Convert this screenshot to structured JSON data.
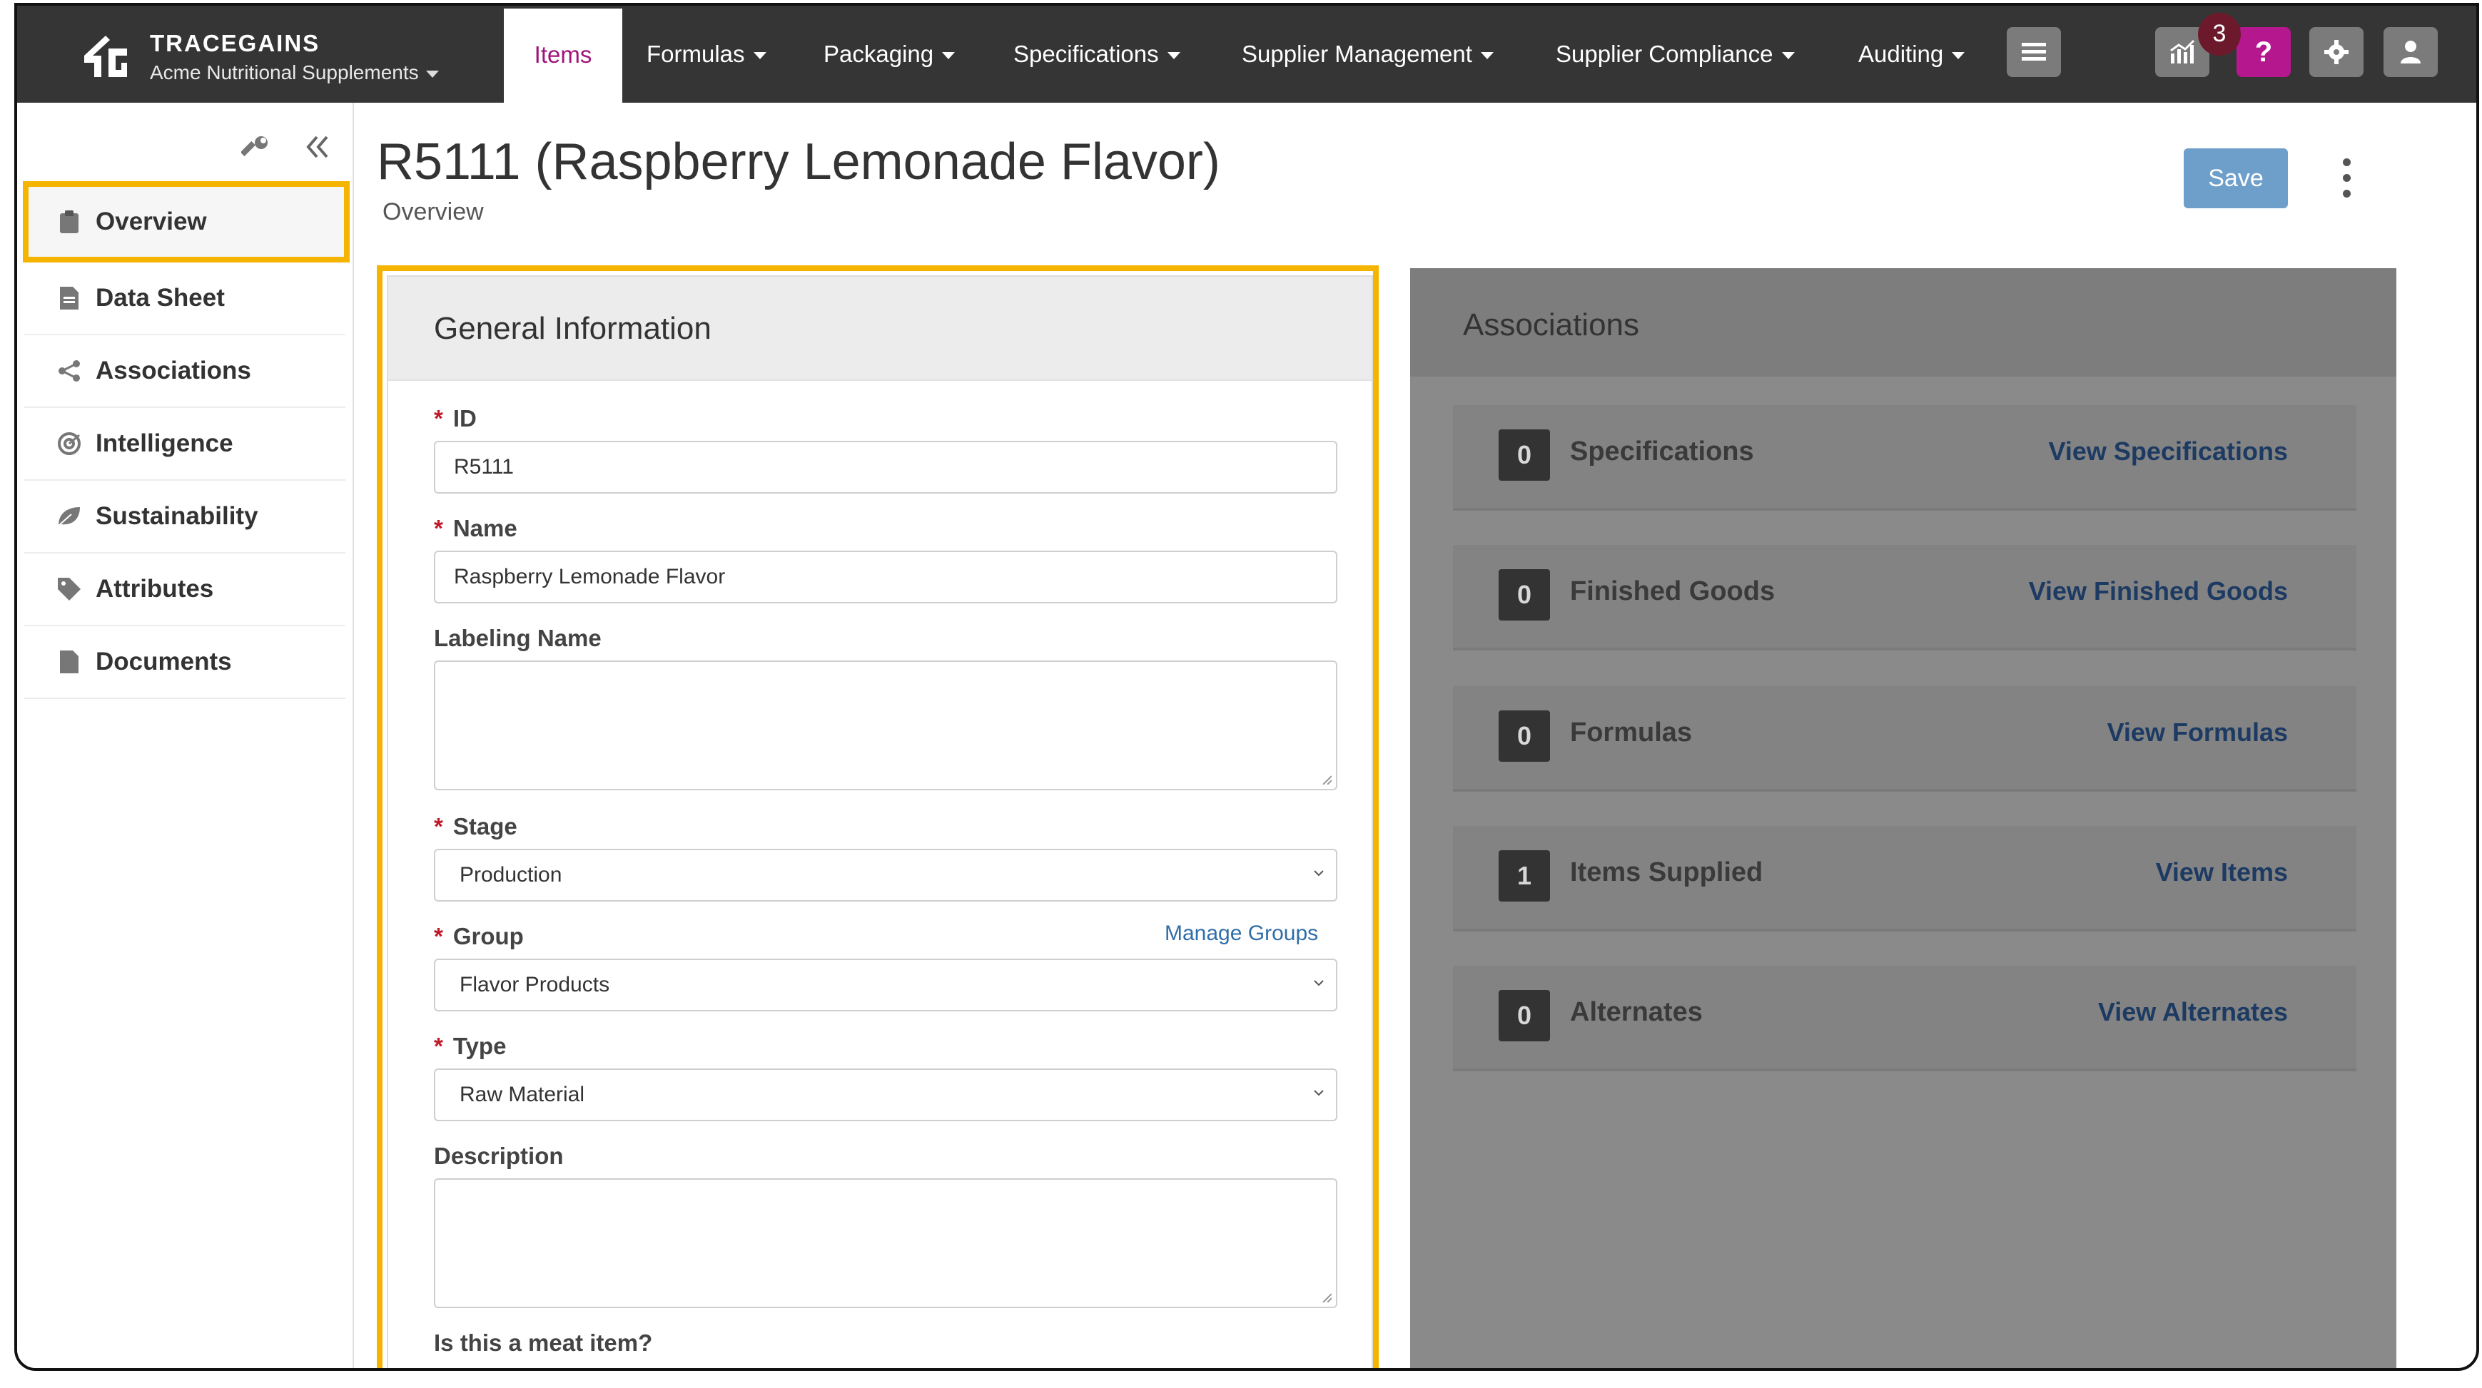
{
  "brand": {
    "name": "TRACEGAINS",
    "org": "Acme Nutritional Supplements"
  },
  "nav": {
    "items": [
      {
        "label": "Items",
        "active": true
      },
      {
        "label": "Formulas"
      },
      {
        "label": "Packaging"
      },
      {
        "label": "Specifications"
      },
      {
        "label": "Supplier Management"
      },
      {
        "label": "Supplier Compliance"
      },
      {
        "label": "Auditing"
      }
    ],
    "notification_count": "3",
    "help_label": "?"
  },
  "sidebar": {
    "items": [
      {
        "label": "Overview",
        "icon": "clipboard-icon",
        "active": true
      },
      {
        "label": "Data Sheet",
        "icon": "file-icon"
      },
      {
        "label": "Associations",
        "icon": "share-icon"
      },
      {
        "label": "Intelligence",
        "icon": "target-icon"
      },
      {
        "label": "Sustainability",
        "icon": "leaf-icon"
      },
      {
        "label": "Attributes",
        "icon": "tag-icon"
      },
      {
        "label": "Documents",
        "icon": "document-icon"
      }
    ]
  },
  "page": {
    "title": "R5111 (Raspberry Lemonade Flavor)",
    "subtitle": "Overview",
    "save_label": "Save"
  },
  "general": {
    "heading": "General Information",
    "id_label": "ID",
    "id_value": "R5111",
    "name_label": "Name",
    "name_value": "Raspberry Lemonade Flavor",
    "labeling_label": "Labeling Name",
    "labeling_value": "",
    "stage_label": "Stage",
    "stage_value": "Production",
    "group_label": "Group",
    "group_value": "Flavor Products",
    "manage_groups": "Manage Groups",
    "type_label": "Type",
    "type_value": "Raw Material",
    "description_label": "Description",
    "description_value": "",
    "meat_label": "Is this a meat item?",
    "required_mark": "*"
  },
  "associations": {
    "heading": "Associations",
    "rows": [
      {
        "count": "0",
        "name": "Specifications",
        "link": "View Specifications"
      },
      {
        "count": "0",
        "name": "Finished Goods",
        "link": "View Finished Goods"
      },
      {
        "count": "0",
        "name": "Formulas",
        "link": "View Formulas"
      },
      {
        "count": "1",
        "name": "Items Supplied",
        "link": "View Items"
      },
      {
        "count": "0",
        "name": "Alternates",
        "link": "View Alternates"
      }
    ]
  },
  "colors": {
    "accent": "#a0147a",
    "highlight": "#f5b400",
    "nav_bg": "#353535",
    "link": "#2f6ea8"
  }
}
